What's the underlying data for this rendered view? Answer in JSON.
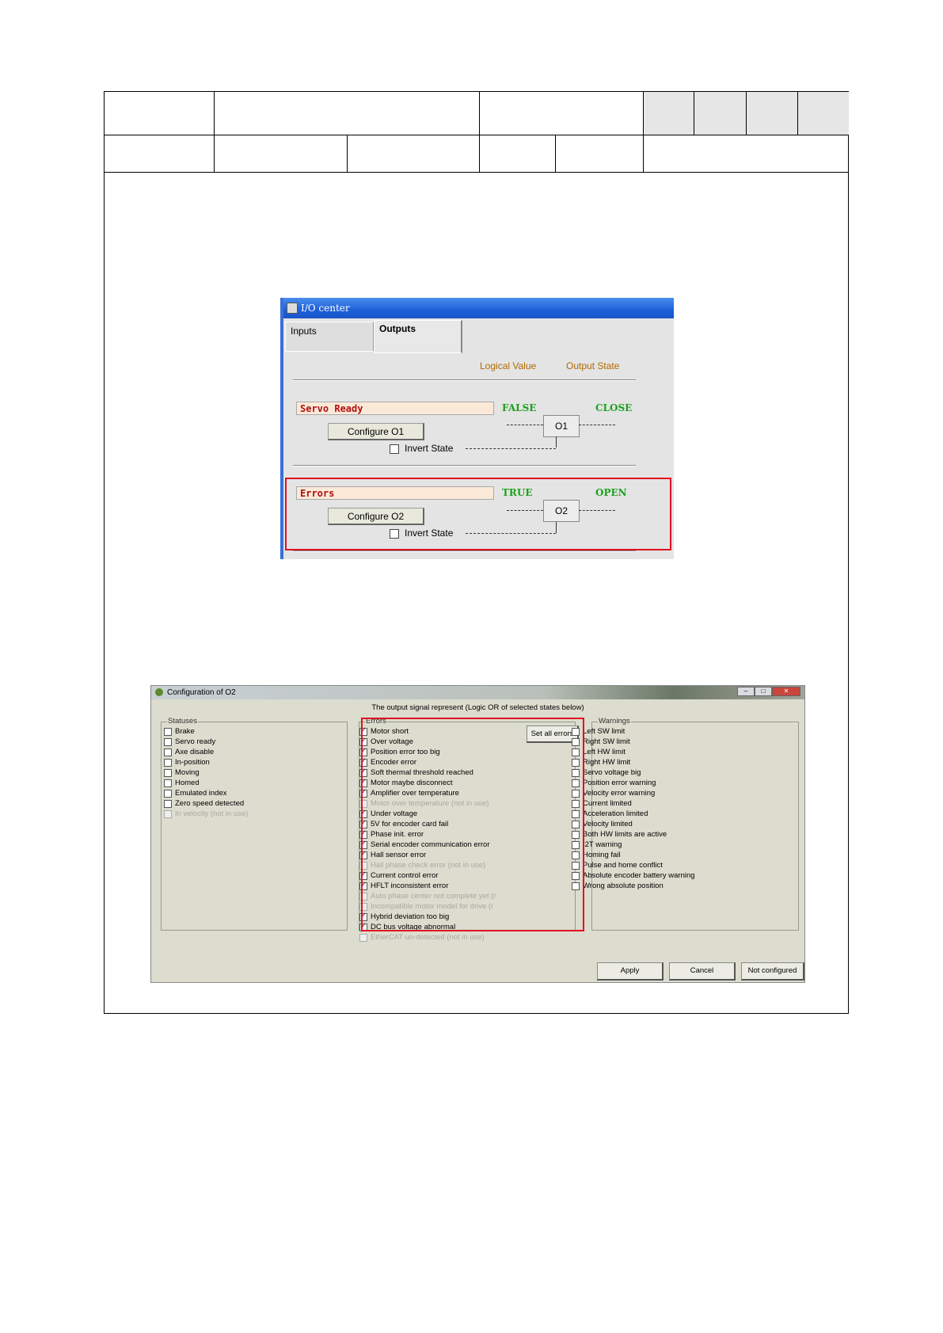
{
  "io_center": {
    "title": "I/O center",
    "tabs": {
      "inputs": "Inputs",
      "outputs": "Outputs"
    },
    "col_logical": "Logical Value",
    "col_state": "Output State",
    "rows": [
      {
        "signal": "Servo Ready",
        "button": "Configure O1",
        "invert": "Invert State",
        "logical": "FALSE",
        "state": "CLOSE",
        "output": "O1"
      },
      {
        "signal": "Errors",
        "button": "Configure O2",
        "invert": "Invert State",
        "logical": "TRUE",
        "state": "OPEN",
        "output": "O2"
      }
    ]
  },
  "config": {
    "title": "Configuration of O2",
    "subtitle": "The output signal represent  (Logic OR of selected states below)",
    "statuses": {
      "label": "Statuses",
      "items": [
        {
          "label": "Brake",
          "checked": false,
          "disabled": false
        },
        {
          "label": "Servo ready",
          "checked": false,
          "disabled": false
        },
        {
          "label": "Axe disable",
          "checked": false,
          "disabled": false
        },
        {
          "label": "In-position",
          "checked": false,
          "disabled": false
        },
        {
          "label": "Moving",
          "checked": false,
          "disabled": false
        },
        {
          "label": "Homed",
          "checked": false,
          "disabled": false
        },
        {
          "label": "Emulated index",
          "checked": false,
          "disabled": false
        },
        {
          "label": "Zero speed detected",
          "checked": false,
          "disabled": false
        },
        {
          "label": "In velocity (not in use)",
          "checked": false,
          "disabled": true
        }
      ]
    },
    "errors": {
      "label": "Errors",
      "set_all": "Set all errors",
      "items": [
        {
          "label": "Motor short",
          "checked": true,
          "disabled": false
        },
        {
          "label": "Over voltage",
          "checked": true,
          "disabled": false
        },
        {
          "label": "Position error too big",
          "checked": true,
          "disabled": false
        },
        {
          "label": "Encoder error",
          "checked": true,
          "disabled": false
        },
        {
          "label": "Soft thermal threshold reached",
          "checked": true,
          "disabled": false
        },
        {
          "label": "Motor maybe disconnect",
          "checked": true,
          "disabled": false
        },
        {
          "label": "Amplifier over temperature",
          "checked": true,
          "disabled": false
        },
        {
          "label": "Motor over temperature (not in use)",
          "checked": false,
          "disabled": true
        },
        {
          "label": "Under voltage",
          "checked": true,
          "disabled": false
        },
        {
          "label": "5V for encoder card fail",
          "checked": true,
          "disabled": false
        },
        {
          "label": "Phase init. error",
          "checked": true,
          "disabled": false
        },
        {
          "label": "Serial encoder communication error",
          "checked": true,
          "disabled": false
        },
        {
          "label": "Hall sensor error",
          "checked": true,
          "disabled": false
        },
        {
          "label": "Hall phase check error (not in use)",
          "checked": false,
          "disabled": true
        },
        {
          "label": "Current control error",
          "checked": true,
          "disabled": false
        },
        {
          "label": "HFLT inconsistent error",
          "checked": true,
          "disabled": false
        },
        {
          "label": "Auto phase center not complete yet (r",
          "checked": false,
          "disabled": true
        },
        {
          "label": "Incompatible motor model for drive (r",
          "checked": false,
          "disabled": true
        },
        {
          "label": "Hybrid deviation too big",
          "checked": true,
          "disabled": false
        },
        {
          "label": "DC bus voltage abnormal",
          "checked": true,
          "disabled": false
        },
        {
          "label": "EtherCAT un-detected (not in use)",
          "checked": false,
          "disabled": true
        }
      ]
    },
    "warnings": {
      "label": "Warnings",
      "items": [
        {
          "label": "Left SW limit",
          "checked": false,
          "disabled": false
        },
        {
          "label": "Right SW limit",
          "checked": false,
          "disabled": false
        },
        {
          "label": "Left HW limit",
          "checked": false,
          "disabled": false
        },
        {
          "label": "Right HW limit",
          "checked": false,
          "disabled": false
        },
        {
          "label": "Servo voltage big",
          "checked": false,
          "disabled": false
        },
        {
          "label": "Position error warning",
          "checked": false,
          "disabled": false
        },
        {
          "label": "Velocity error warning",
          "checked": false,
          "disabled": false
        },
        {
          "label": "Current limited",
          "checked": false,
          "disabled": false
        },
        {
          "label": "Acceleration limited",
          "checked": false,
          "disabled": false
        },
        {
          "label": "Velocity limited",
          "checked": false,
          "disabled": false
        },
        {
          "label": "Both HW limits are active",
          "checked": false,
          "disabled": false
        },
        {
          "label": "I2T warning",
          "checked": false,
          "disabled": false
        },
        {
          "label": "Homing fail",
          "checked": false,
          "disabled": false
        },
        {
          "label": "Pulse and home conflict",
          "checked": false,
          "disabled": false
        },
        {
          "label": "Absolute encoder battery warning",
          "checked": false,
          "disabled": false
        },
        {
          "label": "Wrong absolute position",
          "checked": false,
          "disabled": false
        }
      ]
    },
    "buttons": {
      "apply": "Apply",
      "cancel": "Cancel",
      "not_configured": "Not configured"
    },
    "window_buttons": {
      "minimize": "–",
      "maximize": "□",
      "close": "✕"
    }
  },
  "colors": {
    "highlight": "#e01020",
    "logic_green": "#1ba21b",
    "signal_red": "#b01010",
    "header_gray": "#e6e6e6"
  }
}
